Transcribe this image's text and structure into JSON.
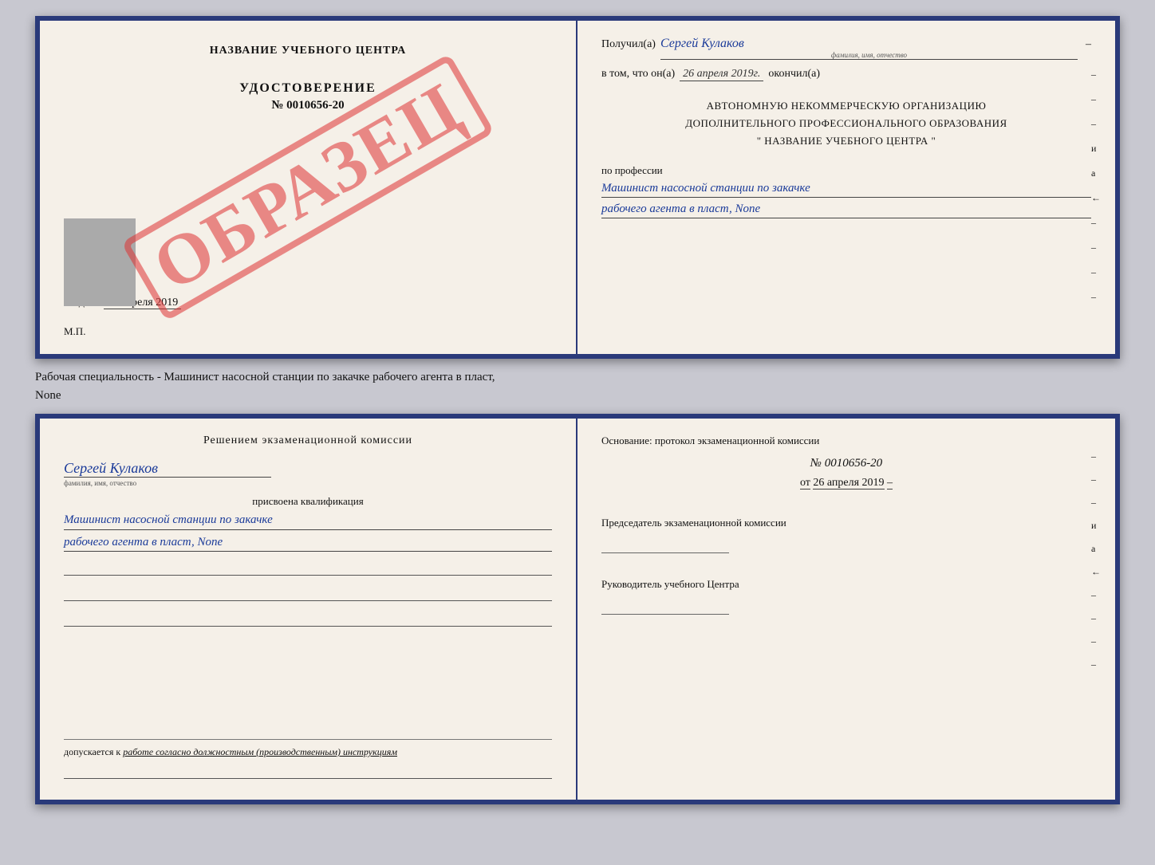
{
  "top_doc": {
    "left": {
      "center_name": "НАЗВАНИЕ УЧЕБНОГО ЦЕНТРА",
      "stamp_text": "ОБРАЗЕЦ",
      "udostoverenie_label": "УДОСТОВЕРЕНИЕ",
      "nomer": "№ 0010656-20",
      "vydano_prefix": "Выдано",
      "vydano_date": "26 апреля 2019",
      "mp_label": "М.П."
    },
    "right": {
      "poluchil_prefix": "Получил(а)",
      "poluchil_value": "Сергей Кулаков",
      "familiya_sub": "фамилия, имя, отчество",
      "vtom_prefix": "в том, что он(а)",
      "vtom_date": "26 апреля 2019г.",
      "okonchil": "окончил(а)",
      "org_line1": "АВТОНОМНУЮ НЕКОММЕРЧЕСКУЮ ОРГАНИЗАЦИЮ",
      "org_line2": "ДОПОЛНИТЕЛЬНОГО ПРОФЕССИОНАЛЬНОГО ОБРАЗОВАНИЯ",
      "org_name": "\" НАЗВАНИЕ УЧЕБНОГО ЦЕНТРА \"",
      "po_professii": "по профессии",
      "profession_line1": "Машинист насосной станции по закачке",
      "profession_line2": "рабочего агента в пласт, None",
      "dashes": [
        "-",
        "-",
        "-",
        "и",
        "а",
        "←",
        "-",
        "-",
        "-",
        "-"
      ]
    }
  },
  "between": {
    "line1": "Рабочая специальность - Машинист насосной станции по закачке рабочего агента в пласт,",
    "line2": "None"
  },
  "bottom_doc": {
    "left": {
      "title": "Решением экзаменационной комиссии",
      "person_name": "Сергей Кулаков",
      "familiya_sub": "фамилия, имя, отчество",
      "prisvoena": "присвоена квалификация",
      "qual_line1": "Машинист насосной станции по закачке",
      "qual_line2": "рабочего агента в пласт, None",
      "dopuskaetsya_prefix": "допускается к",
      "dopuskaetsya_value": "работе согласно должностным (производственным) инструкциям"
    },
    "right": {
      "osnov_title": "Основание: протокол экзаменационной комиссии",
      "proto_number": "№ 0010656-20",
      "ot_prefix": "от",
      "ot_date": "26 апреля 2019",
      "predsedatel_label": "Председатель экзаменационной комиссии",
      "rukovoditel_label": "Руководитель учебного Центра",
      "dashes": [
        "-",
        "-",
        "-",
        "и",
        "а",
        "←",
        "-",
        "-",
        "-",
        "-"
      ]
    }
  }
}
